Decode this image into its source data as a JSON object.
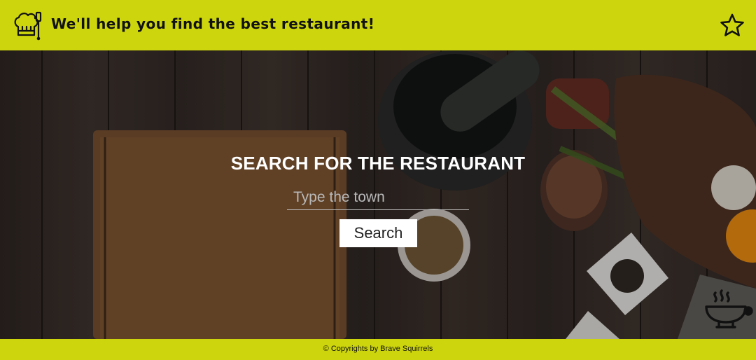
{
  "header": {
    "logo_icon": "chef-hat-icon",
    "title": "We'll help you find the best restaurant!",
    "favorites_icon": "star-icon",
    "background_color": "#cdd60c"
  },
  "hero": {
    "heading": "SEARCH FOR THE RESTAURANT",
    "search": {
      "placeholder": "Type the town",
      "value": ""
    },
    "search_button_label": "Search",
    "corner_icon": "soup-bowl-icon"
  },
  "footer": {
    "text": "© Copyrights by Brave Squirrels",
    "background_color": "#cdd60c"
  }
}
